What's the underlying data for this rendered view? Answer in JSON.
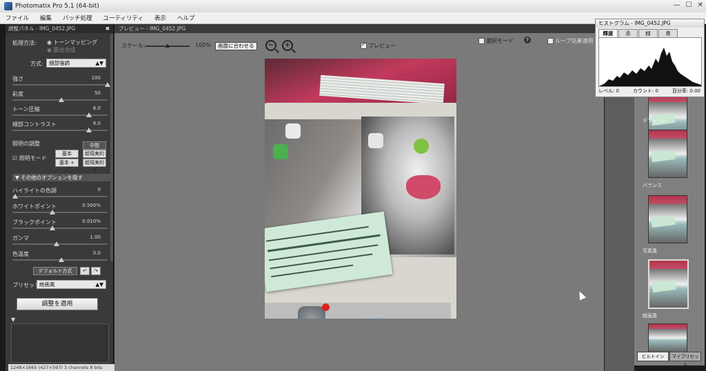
{
  "window": {
    "title": "Photomatix Pro 5.1 (64-bit)",
    "controls": [
      "—",
      "☐",
      "✕"
    ]
  },
  "menu": [
    "ファイル",
    "編集",
    "バッチ処理",
    "ユーティリティ",
    "表示",
    "ヘルプ"
  ],
  "left_panel": {
    "header": "調整パネル - IMG_0452.JPG",
    "close": "✖",
    "method_label": "処理方法:",
    "method_options": [
      "トーンマッピング",
      "露出合成"
    ],
    "method_selected": "トーンマッピング",
    "mode_label": "方式:",
    "mode_value": "細部強調",
    "sliders": [
      {
        "label": "強さ",
        "value": "100",
        "level": 1.0
      },
      {
        "label": "彩度",
        "value": "50",
        "level": 0.5
      },
      {
        "label": "トーン圧縮",
        "value": "6.0",
        "level": 0.8
      },
      {
        "label": "細部コントラスト",
        "value": "6.0",
        "level": 0.8
      }
    ],
    "lighting_label": "照明の調整",
    "lighting_mode_label": "照明モード",
    "lighting_buttons": [
      "中間",
      "基本",
      "超現実的",
      "基本 +",
      "超現実的 +"
    ],
    "more_options": "その他のオプションを隠す",
    "sliders2": [
      {
        "label": "ハイライトの色調",
        "value": "0",
        "level": 0.0
      },
      {
        "label": "ホワイトポイント",
        "value": "0.500%",
        "level": 0.4
      },
      {
        "label": "ブラックポイント",
        "value": "0.010%",
        "level": 0.4
      },
      {
        "label": "ガンマ",
        "value": "1.00",
        "level": 0.45
      },
      {
        "label": "色温度",
        "value": "0.0",
        "level": 0.5
      }
    ],
    "default_button": "デフォルト方式",
    "preset_label": "プリセット:",
    "preset_value": "絵画風",
    "apply_button": "調整を適用"
  },
  "status_bar": "1248×1665 (427×597) 3 channels 8 bits",
  "preview": {
    "header": "プレビュー - IMG_0452.JPG",
    "scale_label": "スケール:",
    "scale_value": "100%",
    "scale_level": 0.5,
    "fit_button": "画面に合わせる",
    "preview_checkbox": "プレビュー",
    "select_mode": "選択モード",
    "help": "?",
    "loupe": "ループ効果適用"
  },
  "histogram": {
    "title": "ヒストグラム - IMG_0452.JPG",
    "tabs": [
      "輝度",
      "赤",
      "緑",
      "青"
    ],
    "active_tab": "輝度",
    "level": "レベル: 0",
    "count": "カウント: 0",
    "percent": "百分率: 0.00"
  },
  "presets_panel": {
    "thumbnails": [
      "デフォルト",
      "バランス",
      "写真風",
      "絵画風",
      ""
    ],
    "tabs": [
      "ビルトイン",
      "マイプリセット"
    ]
  }
}
